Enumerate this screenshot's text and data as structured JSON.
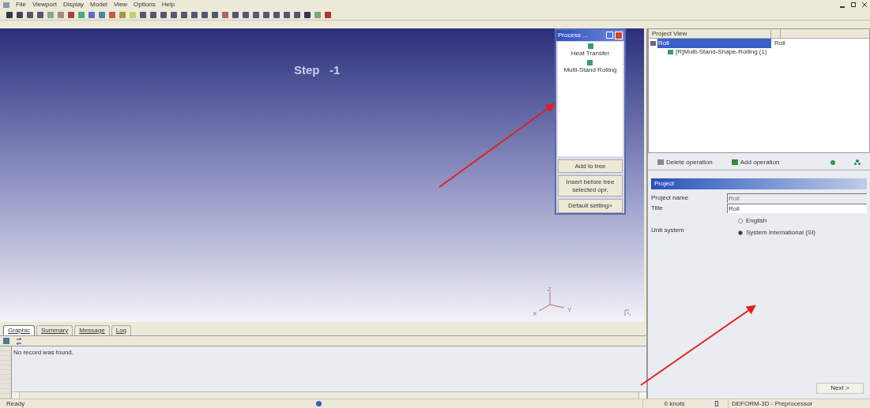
{
  "menu_bar": {
    "items": [
      "File",
      "Viewport",
      "Display",
      "Model",
      "View",
      "Options",
      "Help"
    ]
  },
  "viewport": {
    "step_label": "Step   -1",
    "axes": {
      "z": "Z",
      "x": "X",
      "y": "Y"
    }
  },
  "process_dialog": {
    "title": "Process ...",
    "items": [
      {
        "label": "Heat Transfer",
        "selected": false
      },
      {
        "label": "Multi-Stand Rolling",
        "selected": false
      }
    ],
    "buttons": [
      "Add to tree",
      "Insert before tree selected opr.",
      "Default setting>"
    ]
  },
  "project_view": {
    "columns": [
      "Project View"
    ],
    "tree": [
      {
        "label": "Roll",
        "value": "Roll",
        "selected": true,
        "children": [
          {
            "label": "[R]Multi-Stand-Shape-Rolling (1)",
            "selected": false
          }
        ]
      }
    ]
  },
  "operations_toolbar": {
    "buttons": [
      "Delete operation",
      "Add operation"
    ]
  },
  "project_form": {
    "header": "Project",
    "fields": [
      {
        "label": "Project name",
        "value": "Roll",
        "disabled": true
      },
      {
        "label": "Title",
        "value": "Roll",
        "disabled": false
      }
    ],
    "unit_system": {
      "label": "Unit system",
      "options": [
        {
          "label": "English",
          "selected": false
        },
        {
          "label": "System International (SI)",
          "selected": true
        }
      ]
    }
  },
  "next_button": "Next >",
  "output_tabs": [
    {
      "label": "Graphic",
      "selected": true
    },
    {
      "label": "Summary",
      "selected": false
    },
    {
      "label": "Message",
      "selected": false
    },
    {
      "label": "Log",
      "selected": false
    }
  ],
  "log": {
    "message": "No record was found."
  },
  "status_bar": {
    "left": "Ready",
    "knots": "0 knots",
    "app": "DEFORM-3D - Preprocessor"
  }
}
